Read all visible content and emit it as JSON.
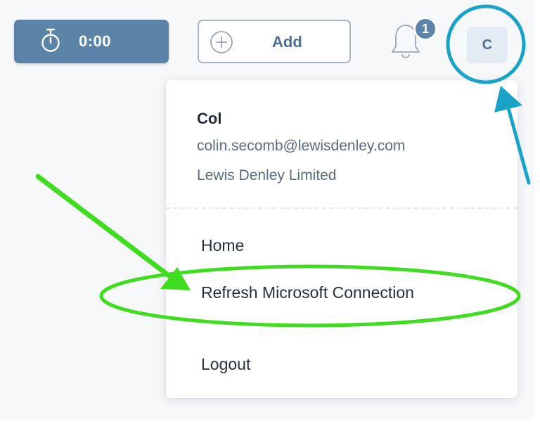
{
  "header": {
    "timer_value": "0:00",
    "add_label": "Add",
    "notification_count": "1",
    "avatar_initial": "C"
  },
  "user_menu": {
    "name": "Col",
    "email": "colin.secomb@lewisdenley.com",
    "company": "Lewis Denley Limited",
    "items": [
      {
        "label": "Home"
      },
      {
        "label": "Refresh Microsoft Connection"
      },
      {
        "label": "Logout"
      }
    ]
  },
  "icons": {
    "timer": "stopwatch-icon",
    "add": "plus-circle-icon",
    "notifications": "bell-icon"
  },
  "colors": {
    "primary": "#5b84a8",
    "avatar_bg": "#e4ebf4",
    "annotation_green": "#3fdc1f",
    "annotation_blue": "#1aa3c9"
  }
}
